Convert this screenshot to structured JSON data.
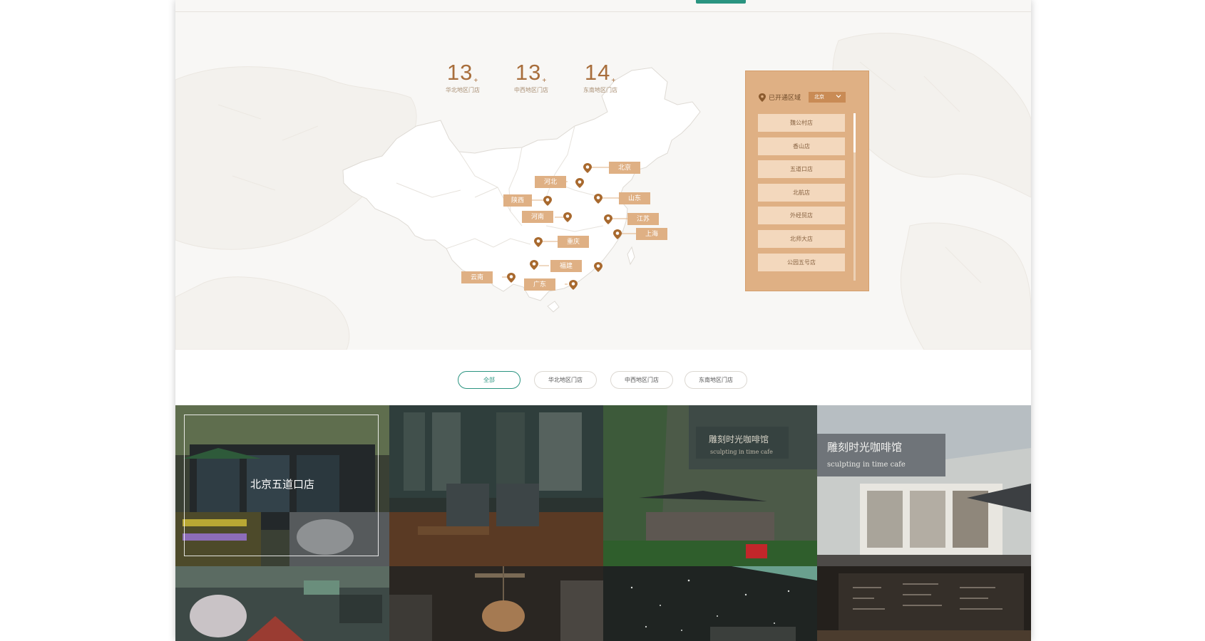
{
  "stats": [
    {
      "number": "13",
      "suffix": "+",
      "label": "华北地区门店"
    },
    {
      "number": "13",
      "suffix": "+",
      "label": "中西地区门店"
    },
    {
      "number": "14",
      "suffix": "+",
      "label": "东南地区门店"
    }
  ],
  "map_labels": [
    "北京",
    "河北",
    "陕西",
    "山东",
    "河南",
    "江苏",
    "上海",
    "重庆",
    "福建",
    "云南",
    "广东"
  ],
  "panel": {
    "heading": "已开通区域",
    "region_value": "北京",
    "stores": [
      "魏公村店",
      "香山店",
      "五道口店",
      "北航店",
      "外经贸店",
      "北师大店",
      "公园五号店"
    ]
  },
  "filters": [
    "全部",
    "华北地区门店",
    "中西地区门店",
    "东南地区门店"
  ],
  "gallery": {
    "featured_title": "北京五道口店",
    "cafe_sign_cn": "雕刻时光咖啡馆",
    "cafe_sign_en": "sculpting in time cafe"
  },
  "icons": {
    "pin": "location-pin-icon",
    "chevron": "chevron-down-icon"
  },
  "colors": {
    "accent": "#2a9480",
    "brand": "#dfb084",
    "stat_number": "#a86e3c",
    "pin": "#a8692e"
  }
}
